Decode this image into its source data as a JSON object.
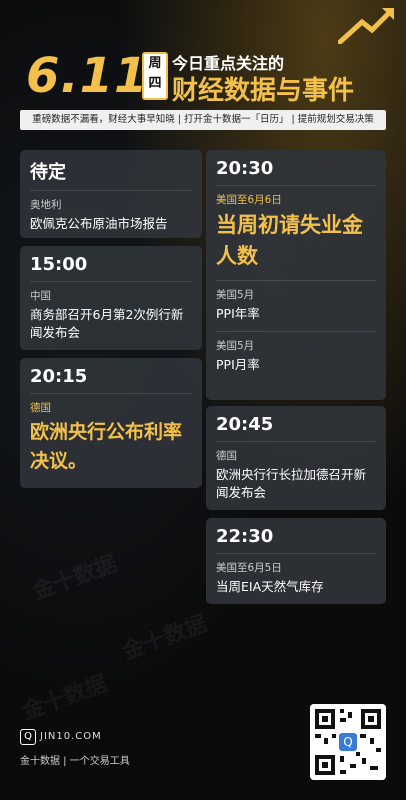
{
  "header": {
    "date": "6.11",
    "weekday": [
      "周",
      "四"
    ],
    "line1": "今日重点关注的",
    "line2": "财经数据与事件"
  },
  "slogan": "重磅数据不漏看，财经大事早知晓 | 打开金十数据一「日历」 | 提前规划交易决策",
  "left_cards": [
    {
      "time": "待定",
      "events": [
        {
          "region": "奥地利",
          "title": "欧佩克公布原油市场报告"
        }
      ]
    },
    {
      "time": "15:00",
      "events": [
        {
          "region": "中国",
          "title": "商务部召开6月第2次例行新闻发布会"
        }
      ]
    },
    {
      "time": "20:15",
      "events": [
        {
          "region": "德国",
          "title": "欧洲央行公布利率决议。"
        }
      ]
    }
  ],
  "right_cards": [
    {
      "time": "20:30",
      "events": [
        {
          "region": "美国至6月6日",
          "title": "当周初请失业金人数"
        },
        {
          "region": "美国5月",
          "title": "PPI年率"
        },
        {
          "region": "美国5月",
          "title": "PPI月率"
        }
      ]
    },
    {
      "time": "20:45",
      "events": [
        {
          "region": "德国",
          "title": "欧洲央行行长拉加德召开新闻发布会"
        }
      ]
    },
    {
      "time": "22:30",
      "events": [
        {
          "region": "美国至6月5日",
          "title": "当周EIA天然气库存"
        }
      ]
    }
  ],
  "footer": {
    "logo_letter": "Q",
    "domain": "JIN10.COM",
    "tagline": "金十数据  |  一个交易工具"
  },
  "watermark": "金十数据"
}
